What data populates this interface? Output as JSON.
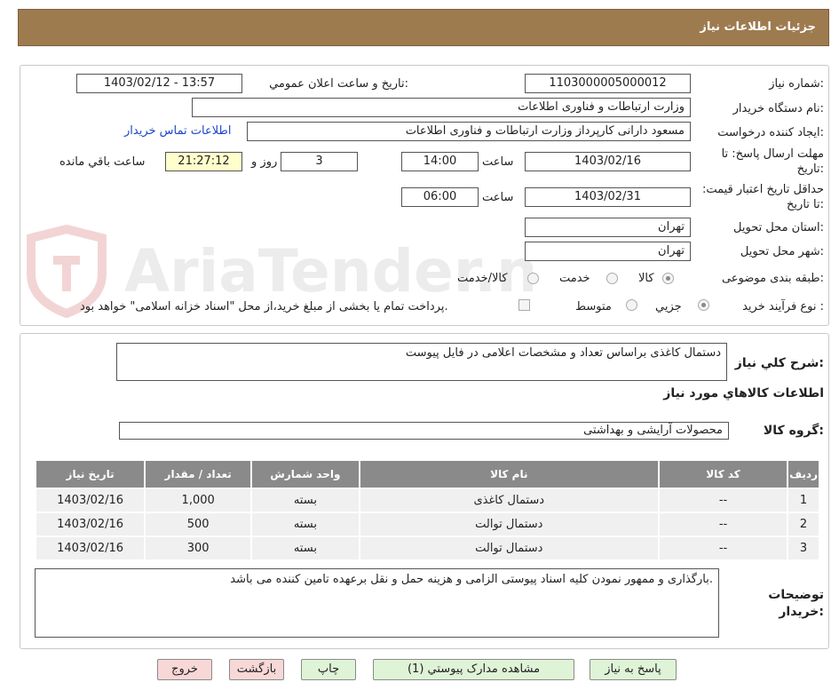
{
  "header": {
    "title": "جزئیات اطلاعات نیاز"
  },
  "form": {
    "need_number_label": "شماره نیاز:",
    "need_number": "1103000005000012",
    "announce_label": "تاریخ و ساعت اعلان عمومي:",
    "announce_value": "1403/02/12 - 13:57",
    "buyer_org_label": "نام دستگاه خريدار:",
    "buyer_org": "وزارت ارتباطات و فناوری اطلاعات",
    "requester_label": "ايجاد کننده درخواست:",
    "requester": "مسعود دارانی کارپرداز وزارت ارتباطات و فناوری اطلاعات",
    "contact_link": "اطلاعات تماس خريدار",
    "deadline_label": "مهلت ارسال پاسخ: تا تاریخ:",
    "deadline_date": "1403/02/16",
    "time_label": "ساعت",
    "deadline_time": "14:00",
    "days": "3",
    "days_label": "روز و",
    "remaining": "21:27:12",
    "remaining_label": "ساعت باقي مانده",
    "validity_label": "حداقل تاريخ اعتبار قيمت: تا تاريخ:",
    "validity_date": "1403/02/31",
    "validity_time": "06:00",
    "province_label": "استان محل تحويل:",
    "province": "تهران",
    "city_label": "شهر محل تحويل:",
    "city": "تهران",
    "category_label": "طبقه بندی موضوعی:",
    "category_options": [
      "کالا",
      "خدمت",
      "کالا/خدمت"
    ],
    "process_label": "نوع فرآيند خريد :",
    "process_options": [
      "جزیي",
      "متوسط"
    ],
    "payment_note": "پرداخت تمام يا بخشی از مبلغ خريد،از محل \"اسناد خزانه اسلامی\" خواهد بود."
  },
  "summary": {
    "description_label": "شرح کلي نياز:",
    "description": "دستمال کاغذی براساس تعداد و مشخصات اعلامی در فایل پیوست",
    "goods_info_title": "اطلاعات کالاهاي مورد نياز",
    "goods_group_label": "گروه کالا:",
    "goods_group": "محصولات آرايشی و بهداشتی"
  },
  "table": {
    "headers": [
      "رديف",
      "کد کالا",
      "نام کالا",
      "واحد شمارش",
      "تعداد / مقدار",
      "تاريخ نياز"
    ],
    "rows": [
      [
        "1",
        "--",
        "دستمال کاغذی",
        "بسته",
        "1,000",
        "1403/02/16"
      ],
      [
        "2",
        "--",
        "دستمال توالت",
        "بسته",
        "500",
        "1403/02/16"
      ],
      [
        "3",
        "--",
        "دستمال توالت",
        "بسته",
        "300",
        "1403/02/16"
      ]
    ]
  },
  "buyer_notes": {
    "label": "توضيحات خريدار:",
    "text": "بارگذاری و ممهور نمودن کلیه اسناد پیوستی الزامی و هزینه حمل و نقل برعهده تامین کننده می باشد."
  },
  "buttons": {
    "reply": "پاسخ به نياز",
    "attachments": "مشاهده مدارک پيوستي (1)",
    "print": "چاپ",
    "back": "بازگشت",
    "exit": "خروج"
  },
  "watermark": {
    "text": "AriaTender.net"
  },
  "colors": {
    "header": "#9e7b4f",
    "table_header": "#8a8a8a",
    "green_button": "#dff3d6",
    "red_button": "#f8d7d7"
  }
}
